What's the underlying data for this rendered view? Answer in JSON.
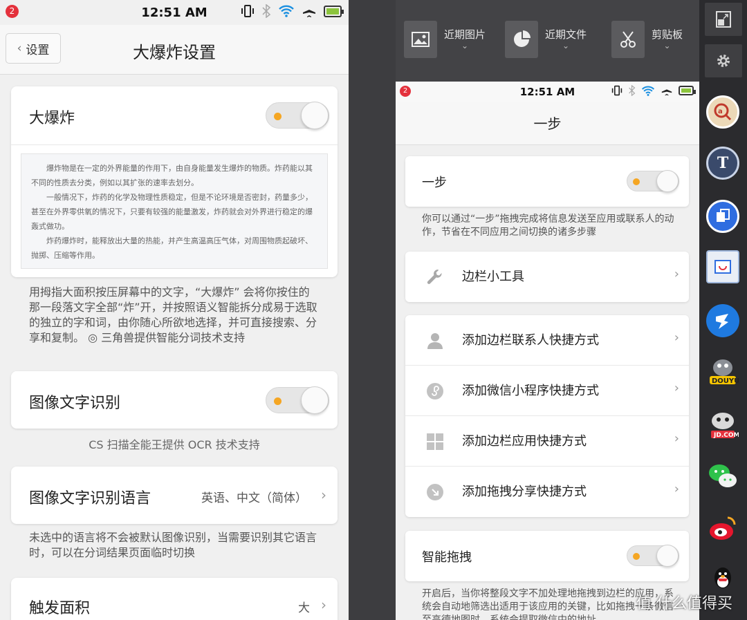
{
  "left": {
    "status_bar": {
      "badge": "2",
      "time": "12:51 AM"
    },
    "header": {
      "back_label": "设置",
      "title": "大爆炸设置"
    },
    "bigbang": {
      "label": "大爆炸",
      "sample_paragraphs": [
        "爆炸物是在一定的外界能量的作用下，由自身能量发生爆炸的物质。炸药能以其不同的性质去分类，例如以其扩张的速率去划分。",
        "一般情况下，炸药的化学及物理性质稳定，但是不论环境是否密封，药量多少，甚至在外界零供氧的情况下，只要有较强的能量激发，炸药就会对外界进行稳定的爆轰式做功。",
        "炸药爆炸时，能释放出大量的热能，并产生高温高压气体，对周围物质起破坏、抛掷、压缩等作用。"
      ],
      "description": "用拇指大面积按压屏幕中的文字，“大爆炸” 会将你按住的那一段落文字全部“炸”开，并按照语义智能拆分成易于选取的独立的字和词，由你随心所欲地选择，并可直接搜索、分享和复制。 ◎ 三角兽提供智能分词技术支持"
    },
    "ocr": {
      "label": "图像文字识别",
      "note": "CS 扫描全能王提供 OCR 技术支持"
    },
    "ocr_lang": {
      "label": "图像文字识别语言",
      "value": "英语、中文（简体）",
      "description": "未选中的语言将不会被默认图像识别，当需要识别其它语言时，可以在分词结果页面临时切换"
    },
    "trigger_area": {
      "label": "触发面积",
      "value": "大"
    }
  },
  "tray": {
    "items": [
      {
        "label": "近期图片"
      },
      {
        "label": "近期文件"
      },
      {
        "label": "剪贴板"
      }
    ]
  },
  "right": {
    "status_bar": {
      "badge": "2",
      "time": "12:51 AM"
    },
    "title": "一步",
    "onestep": {
      "label": "一步",
      "description": "你可以通过“一步”拖拽完成将信息发送至应用或联系人的动作，节省在不同应用之间切换的诸多步骤"
    },
    "sidebar_tools": {
      "label": "边栏小工具"
    },
    "shortcuts": [
      {
        "label": "添加边栏联系人快捷方式"
      },
      {
        "label": "添加微信小程序快捷方式"
      },
      {
        "label": "添加边栏应用快捷方式"
      },
      {
        "label": "添加拖拽分享快捷方式"
      }
    ],
    "smart_drag": {
      "label": "智能拖拽",
      "description": "开启后，当你将整段文字不加处理地拖拽到边栏的应用，系统会自动地筛选出适用于该应用的关键，比如拖拽一条微信至高德地图时，系统会提取微信中的地址"
    }
  },
  "sidebar": {
    "apps": [
      "search-app",
      "text-app",
      "copy-app",
      "screenshot-app",
      "dingtalk-app",
      "douyu-app",
      "jd-app",
      "wechat-app",
      "weibo-app",
      "qq-app"
    ]
  },
  "watermark": "值 什么值得买",
  "colors": {
    "accent": "#f5a623",
    "badge": "#e4313c",
    "battery": "#8cc43d"
  }
}
